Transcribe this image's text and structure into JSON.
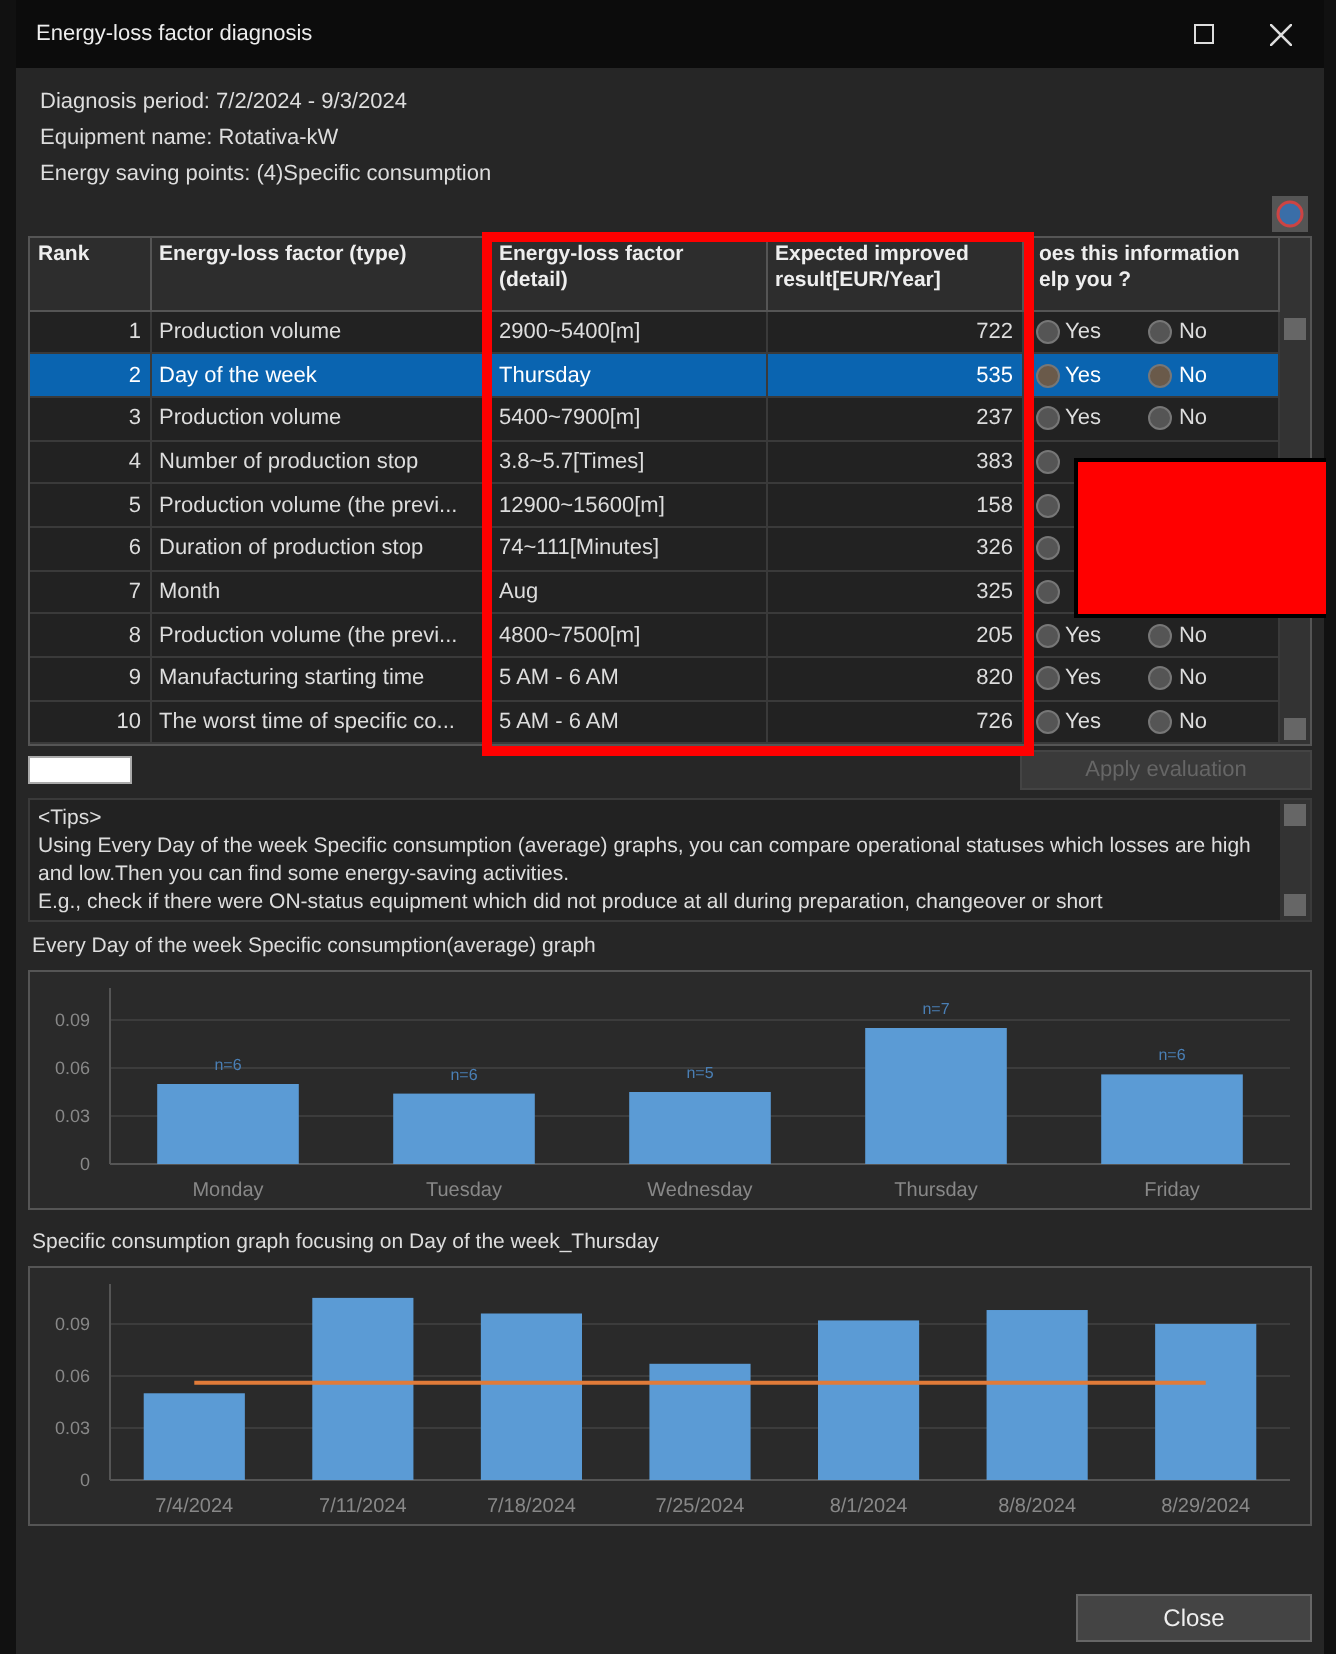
{
  "window": {
    "title": "Energy-loss factor diagnosis"
  },
  "info": [
    "Diagnosis period: 7/2/2024 - 9/3/2024",
    "Equipment name: Rotativa-kW",
    "Energy saving points: (4)Specific consumption"
  ],
  "table": {
    "columns": [
      "Rank",
      "Energy-loss factor (type)",
      "Energy-loss factor (detail)",
      "Expected improved result[EUR/Year]",
      "oes this information elp you ?"
    ],
    "rows": [
      {
        "rank": "1",
        "type": "Production volume",
        "detail": "2900~5400[m]",
        "result": "722",
        "yes": "Yes",
        "no": "No",
        "selected": false
      },
      {
        "rank": "2",
        "type": "Day of the week",
        "detail": "Thursday",
        "result": "535",
        "yes": "Yes",
        "no": "No",
        "selected": true
      },
      {
        "rank": "3",
        "type": "Production volume",
        "detail": "5400~7900[m]",
        "result": "237",
        "yes": "Yes",
        "no": "No",
        "selected": false
      },
      {
        "rank": "4",
        "type": "Number of production stop",
        "detail": "3.8~5.7[Times]",
        "result": "383",
        "selected": false
      },
      {
        "rank": "5",
        "type": "Production volume (the previ...",
        "detail": "12900~15600[m]",
        "result": "158",
        "selected": false
      },
      {
        "rank": "6",
        "type": "Duration of production stop",
        "detail": "74~111[Minutes]",
        "result": "326",
        "selected": false
      },
      {
        "rank": "7",
        "type": "Month",
        "detail": "Aug",
        "result": "325",
        "selected": false
      },
      {
        "rank": "8",
        "type": "Production volume (the previ...",
        "detail": "4800~7500[m]",
        "result": "205",
        "yes": "Yes",
        "no": "No",
        "selected": false
      },
      {
        "rank": "9",
        "type": "Manufacturing starting time",
        "detail": "5 AM - 6 AM",
        "result": "820",
        "yes": "Yes",
        "no": "No",
        "selected": false
      },
      {
        "rank": "10",
        "type": "The worst time of specific co...",
        "detail": "5 AM - 6 AM",
        "result": "726",
        "yes": "Yes",
        "no": "No",
        "selected": false
      }
    ]
  },
  "annotations": {
    "highlight_frame": true,
    "cover_block": true
  },
  "apply_button": {
    "label": "Apply evaluation",
    "disabled": true
  },
  "tips": [
    "<Tips>",
    "Using Every Day of the week Specific consumption (average) graphs, you can compare operational statuses which losses are high and low.Then you can find some energy-saving activities.",
    "E.g., check if there were ON-status equipment which did not produce at all during preparation, changeover or short"
  ],
  "chart1": {
    "title": "Every Day of the week Specific consumption(average) graph",
    "chart_data": {
      "type": "bar",
      "grid": true,
      "categories": [
        "Monday",
        "Tuesday",
        "Wednesday",
        "Thursday",
        "Friday"
      ],
      "series": [
        {
          "type": "bar",
          "color": "#5b9bd5",
          "values": [
            0.05,
            0.044,
            0.045,
            0.085,
            0.056
          ]
        }
      ],
      "ylim": [
        0,
        0.11
      ],
      "yticks": [
        0,
        {
          "value": 0.03,
          "label": "0.03"
        },
        {
          "value": 0.06,
          "label": "0.06"
        },
        {
          "value": 0.09,
          "label": "0.09"
        }
      ],
      "value_labels": [
        "n=6",
        "n=6",
        "n=5",
        "n=7",
        "n=6"
      ]
    }
  },
  "chart2": {
    "title": "Specific consumption graph focusing on Day of the week_Thursday",
    "chart_data": {
      "type": "bar",
      "grid": true,
      "categories": [
        "7/4/2024",
        "7/11/2024",
        "7/18/2024",
        "7/25/2024",
        "8/1/2024",
        "8/8/2024",
        "8/29/2024"
      ],
      "series": [
        {
          "type": "bar",
          "color": "#5b9bd5",
          "values": [
            0.05,
            0.105,
            0.096,
            0.067,
            0.092,
            0.098,
            0.09
          ]
        },
        {
          "type": "line",
          "color": "#e07b39",
          "values": [
            0.056,
            0.056,
            0.056,
            0.056,
            0.056,
            0.056,
            0.056
          ]
        }
      ],
      "ylim": [
        0,
        0.113
      ],
      "yticks": [
        0,
        {
          "value": 0.03,
          "label": "0.03"
        },
        {
          "value": 0.06,
          "label": "0.06"
        },
        {
          "value": 0.09,
          "label": "0.09"
        }
      ]
    }
  },
  "close_button": {
    "label": "Close"
  }
}
